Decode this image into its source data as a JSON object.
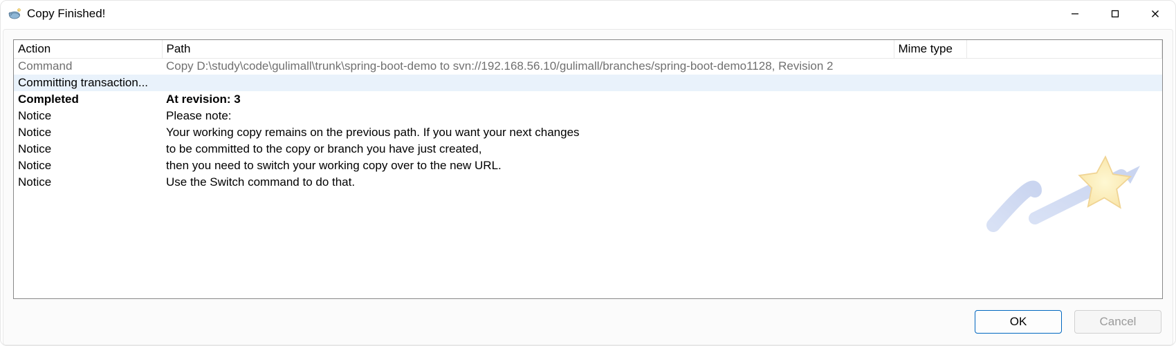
{
  "window": {
    "title": "Copy Finished!"
  },
  "buttons": {
    "ok": "OK",
    "cancel": "Cancel"
  },
  "columns": {
    "action": "Action",
    "path": "Path",
    "mime": "Mime type"
  },
  "rows": [
    {
      "style": "muted",
      "action": "Command",
      "path": "Copy D:\\study\\code\\gulimall\\trunk\\spring-boot-demo to svn://192.168.56.10/gulimall/branches/spring-boot-demo1128, Revision 2",
      "mime": ""
    },
    {
      "style": "highlight",
      "action": "Committing transaction...",
      "path": "",
      "mime": ""
    },
    {
      "style": "bold",
      "action": "Completed",
      "path": "At revision: 3",
      "mime": ""
    },
    {
      "style": "",
      "action": "Notice",
      "path": "Please note:",
      "mime": ""
    },
    {
      "style": "",
      "action": "Notice",
      "path": "Your working copy remains on the previous path. If you want your next changes",
      "mime": ""
    },
    {
      "style": "",
      "action": "Notice",
      "path": "to be committed to the copy or branch you have just created,",
      "mime": ""
    },
    {
      "style": "",
      "action": "Notice",
      "path": "then you need to switch your working copy over to the new URL.",
      "mime": ""
    },
    {
      "style": "",
      "action": "Notice",
      "path": "Use the Switch command to do that.",
      "mime": ""
    }
  ]
}
